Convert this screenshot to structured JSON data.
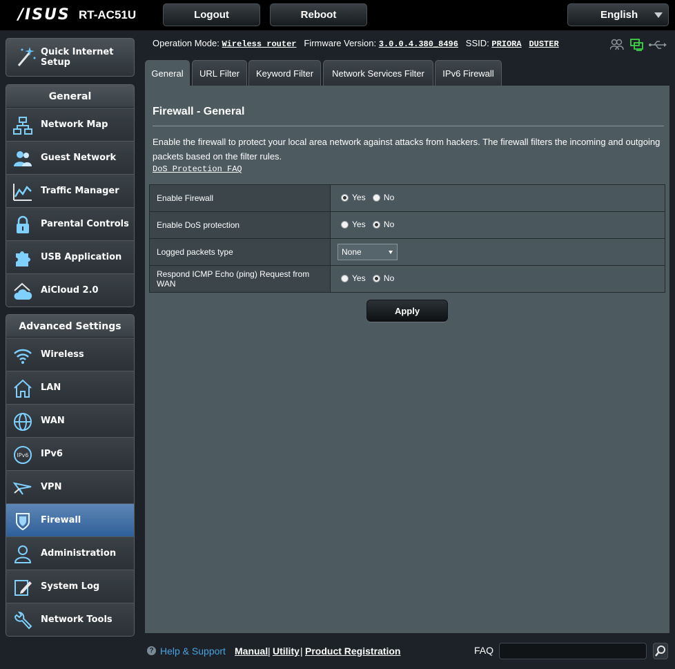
{
  "header": {
    "brand": "/ISUS",
    "model": "RT-AC51U",
    "logout_label": "Logout",
    "reboot_label": "Reboot",
    "language": "English"
  },
  "info": {
    "op_mode_label": "Operation Mode:",
    "op_mode_value": "Wireless router",
    "firmware_label": "Firmware Version:",
    "firmware_value": "3.0.0.4.380_8496",
    "ssid_label": "SSID:",
    "ssid_1": "PRIORA",
    "ssid_2": "DUSTER"
  },
  "sidebar": {
    "qis_line1": "Quick Internet",
    "qis_line2": "Setup",
    "general_title": "General",
    "general_items": [
      "Network Map",
      "Guest Network",
      "Traffic Manager",
      "Parental Controls",
      "USB Application",
      "AiCloud 2.0"
    ],
    "advanced_title": "Advanced Settings",
    "advanced_items": [
      "Wireless",
      "LAN",
      "WAN",
      "IPv6",
      "VPN",
      "Firewall",
      "Administration",
      "System Log",
      "Network Tools"
    ]
  },
  "tabs": [
    "General",
    "URL Filter",
    "Keyword Filter",
    "Network Services Filter",
    "IPv6 Firewall"
  ],
  "main": {
    "title": "Firewall - General",
    "description": "Enable the firewall to protect your local area network against attacks from hackers. The firewall filters the incoming and outgoing packets based on the filter rules.",
    "faq_link": "DoS Protection FAQ",
    "rows": {
      "enable_firewall": "Enable Firewall",
      "enable_dos": "Enable DoS protection",
      "logged_packets": "Logged packets type",
      "respond_icmp": "Respond ICMP Echo (ping) Request from WAN"
    },
    "yes": "Yes",
    "no": "No",
    "logged_packets_value": "None",
    "apply_label": "Apply"
  },
  "footer": {
    "help": "Help & Support",
    "manual": "Manual",
    "utility": "Utility",
    "registration": "Product Registration",
    "sep": "|",
    "faq": "FAQ"
  }
}
